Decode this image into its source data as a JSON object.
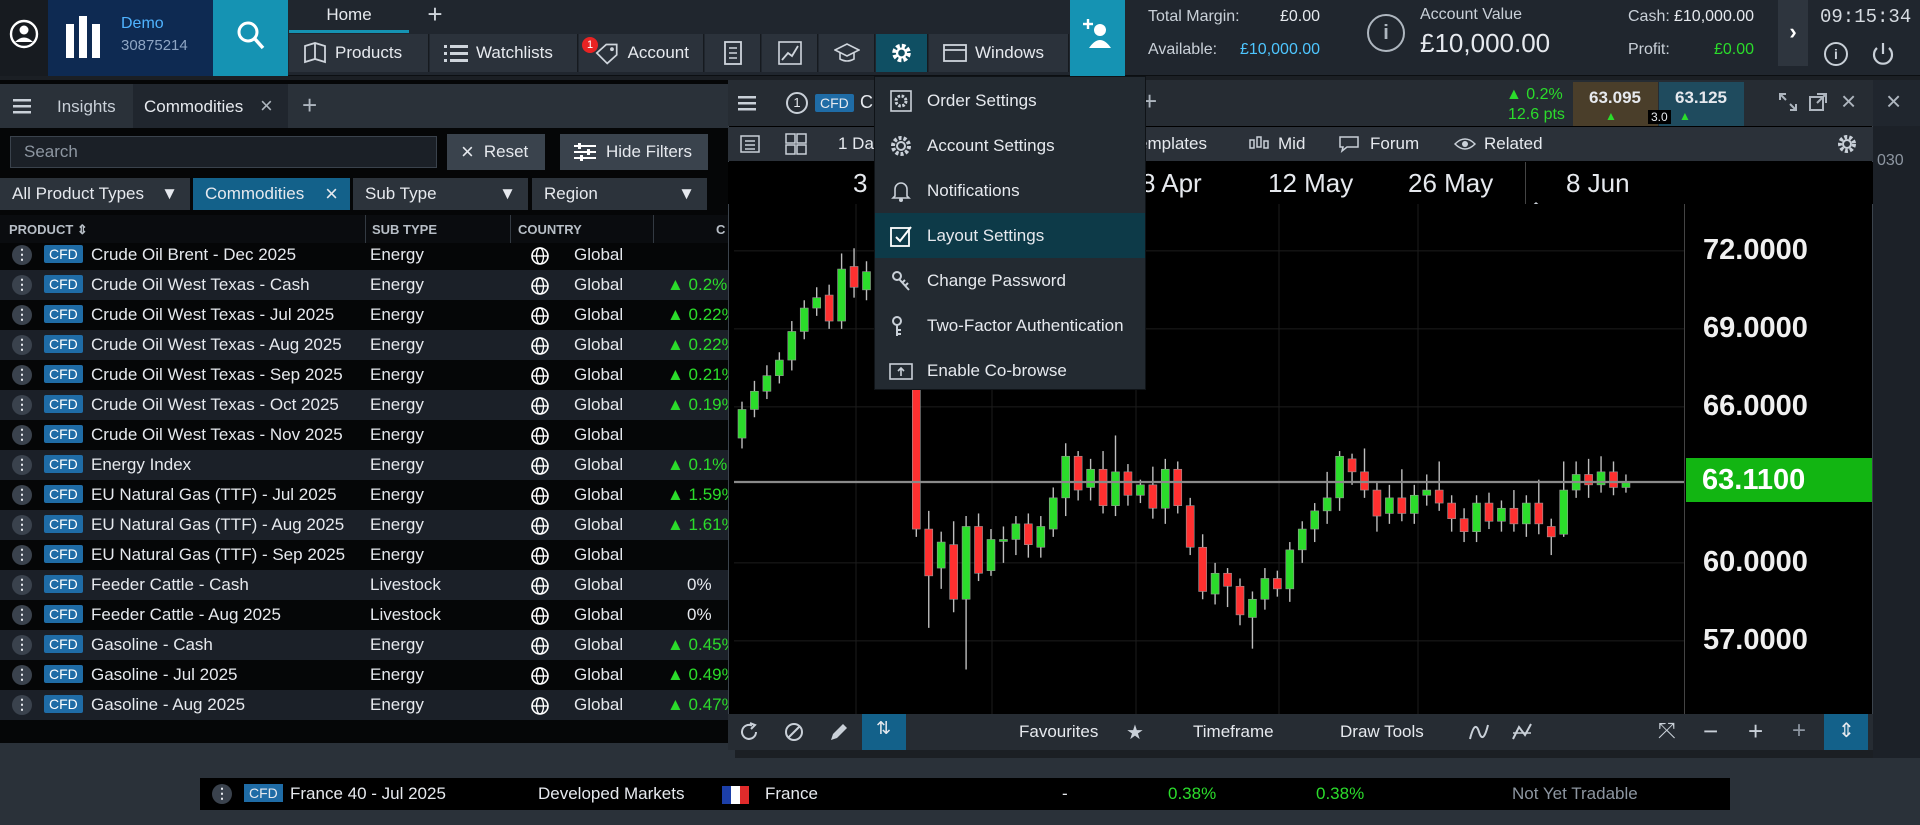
{
  "topbar": {
    "account_name": "Demo",
    "account_number": "30875214",
    "home_tab": "Home",
    "products": "Products",
    "watchlists": "Watchlists",
    "account": "Account",
    "account_badge": "1",
    "windows": "Windows",
    "total_margin_label": "Total Margin:",
    "total_margin": "£0.00",
    "available_label": "Available:",
    "available": "£10,000.00",
    "account_value_label": "Account Value",
    "account_value": "£10,000.00",
    "cash_label": "Cash:",
    "cash": "£10,000.00",
    "profit_label": "Profit:",
    "profit": "£0.00",
    "clock": "09:15:34"
  },
  "left": {
    "tab_insights": "Insights",
    "tab_commodities": "Commodities",
    "search_placeholder": "Search",
    "reset": "Reset",
    "hide_filters": "Hide Filters",
    "filter_types": "All Product Types",
    "filter_commodities": "Commodities",
    "filter_subtype": "Sub Type",
    "filter_region": "Region",
    "col_product": "PRODUCT",
    "col_subtype": "SUB TYPE",
    "col_country": "COUNTRY",
    "col_change": "C",
    "rows": [
      {
        "name": "Crude Oil Brent - Dec 2025",
        "sub": "Energy",
        "country": "Global",
        "chg": ""
      },
      {
        "name": "Crude Oil West Texas - Cash",
        "sub": "Energy",
        "country": "Global",
        "chg": "▲ 0.2%"
      },
      {
        "name": "Crude Oil West Texas - Jul 2025",
        "sub": "Energy",
        "country": "Global",
        "chg": "▲ 0.22%"
      },
      {
        "name": "Crude Oil West Texas - Aug 2025",
        "sub": "Energy",
        "country": "Global",
        "chg": "▲ 0.22%"
      },
      {
        "name": "Crude Oil West Texas - Sep 2025",
        "sub": "Energy",
        "country": "Global",
        "chg": "▲ 0.21%"
      },
      {
        "name": "Crude Oil West Texas - Oct 2025",
        "sub": "Energy",
        "country": "Global",
        "chg": "▲ 0.19%"
      },
      {
        "name": "Crude Oil West Texas - Nov 2025",
        "sub": "Energy",
        "country": "Global",
        "chg": ""
      },
      {
        "name": "Energy Index",
        "sub": "Energy",
        "country": "Global",
        "chg": "▲ 0.1%"
      },
      {
        "name": "EU Natural Gas (TTF) - Jul 2025",
        "sub": "Energy",
        "country": "Global",
        "chg": "▲ 1.59%"
      },
      {
        "name": "EU Natural Gas (TTF) - Aug 2025",
        "sub": "Energy",
        "country": "Global",
        "chg": "▲ 1.61%"
      },
      {
        "name": "EU Natural Gas (TTF) - Sep 2025",
        "sub": "Energy",
        "country": "Global",
        "chg": ""
      },
      {
        "name": "Feeder Cattle - Cash",
        "sub": "Livestock",
        "country": "Global",
        "chg": "0%"
      },
      {
        "name": "Feeder Cattle - Aug 2025",
        "sub": "Livestock",
        "country": "Global",
        "chg": "0%"
      },
      {
        "name": "Gasoline - Cash",
        "sub": "Energy",
        "country": "Global",
        "chg": "▲ 0.45%"
      },
      {
        "name": "Gasoline - Jul 2025",
        "sub": "Energy",
        "country": "Global",
        "chg": "▲ 0.49%"
      },
      {
        "name": "Gasoline - Aug 2025",
        "sub": "Energy",
        "country": "Global",
        "chg": "▲ 0.47%"
      }
    ],
    "cfd": "CFD"
  },
  "chart": {
    "cfd": "CFD",
    "title_partial": "C",
    "change_pct": "▲ 0.2%",
    "change_pts": "12.6 pts",
    "sell": "63.095",
    "buy": "63.125",
    "spread": "3.0",
    "interval": "1 Da",
    "templates": "emplates",
    "mid": "Mid",
    "forum": "Forum",
    "related": "Related",
    "right_edge_label": "030",
    "dates": [
      "3",
      "8 Apr",
      "12 May",
      "26 May",
      "8 Jun"
    ],
    "prices": [
      "72.0000",
      "69.0000",
      "66.0000",
      "60.0000",
      "57.0000"
    ],
    "current_price": "63.1100",
    "favourites": "Favourites",
    "timeframe": "Timeframe",
    "draw_tools": "Draw Tools"
  },
  "menu": {
    "items": [
      "Order Settings",
      "Account Settings",
      "Notifications",
      "Layout Settings",
      "Change Password",
      "Two-Factor Authentication",
      "Enable Co-browse"
    ]
  },
  "bottom": {
    "cfd": "CFD",
    "row1_name": "France 40 - Jul 2025",
    "row1_sub": "Developed Markets",
    "row1_country": "France",
    "row1_dash": "-",
    "row1_chg1": "0.38%",
    "row1_chg2": "0.38%",
    "row1_status": "Not Yet Tradable"
  },
  "colors": {
    "accent": "#1593b3",
    "up": "#2bdc2b",
    "down": "#ff3030",
    "brand": "#0e2a52"
  }
}
